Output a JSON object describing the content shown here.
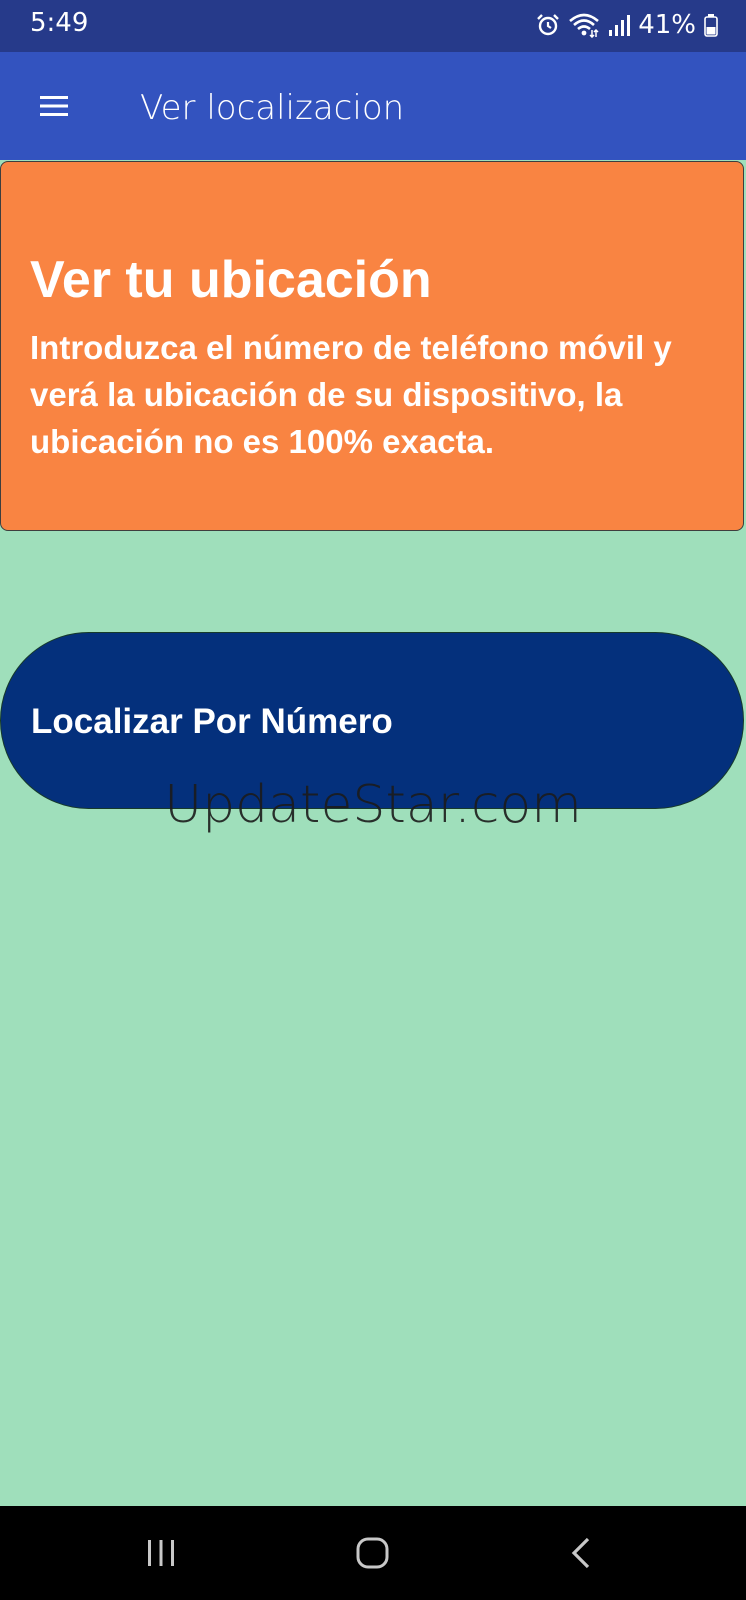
{
  "status_bar": {
    "time": "5:49",
    "battery": "41%",
    "icons": [
      "alarm-icon",
      "wifi-icon",
      "signal-icon",
      "battery-icon"
    ]
  },
  "app_bar": {
    "menu_icon": "hamburger-menu-icon",
    "title": "Ver localizacion"
  },
  "info_card": {
    "title": "Ver tu ubicación",
    "description": "Introduzca el número de teléfono móvil y verá la ubicación de su dispositivo, la ubicación no es 100% exacta."
  },
  "locate_button": {
    "label": "Localizar Por Número"
  },
  "watermark": "UpdateStar.com",
  "nav_bar": {
    "buttons": [
      "recents-icon",
      "home-icon",
      "back-icon"
    ]
  },
  "colors": {
    "status_bar": "#263a8a",
    "app_bar": "#3353bf",
    "background": "#9fdfbb",
    "card": "#f98442",
    "button": "#04307c"
  }
}
